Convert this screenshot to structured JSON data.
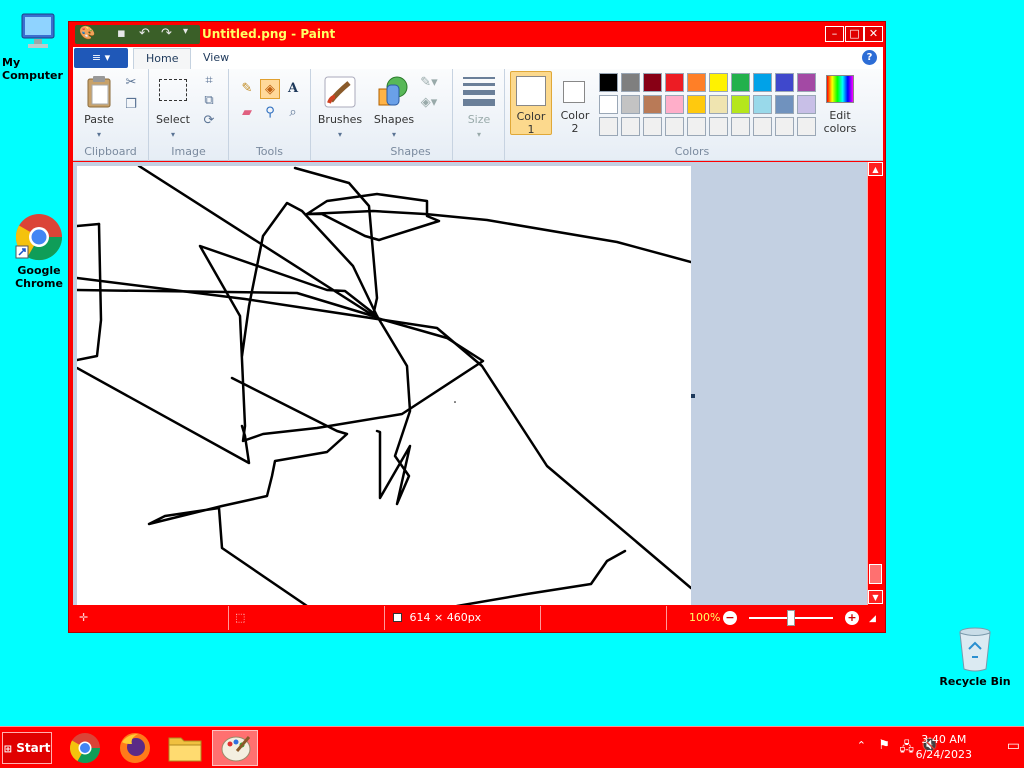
{
  "desktop": {
    "icons": [
      {
        "label": "My Computer"
      },
      {
        "label": "Google Chrome"
      },
      {
        "label": "Recycle Bin"
      }
    ]
  },
  "window": {
    "title": "Untitled.png - Paint",
    "controls": {
      "minimize": "–",
      "maximize": "□",
      "close": "✕"
    },
    "menu_button": "≡ ▾",
    "tabs": [
      {
        "label": "Home"
      },
      {
        "label": "View"
      }
    ],
    "help": "?"
  },
  "ribbon": {
    "clipboard": {
      "group": "Clipboard",
      "paste": "Paste"
    },
    "image": {
      "group": "Image",
      "select": "Select"
    },
    "tools": {
      "group": "Tools",
      "text_glyph": "A"
    },
    "brushes": {
      "label": "Brushes"
    },
    "shapes": {
      "group": "Shapes",
      "label": "Shapes"
    },
    "size": {
      "label": "Size"
    },
    "colors": {
      "group": "Colors",
      "color1": "Color\n1",
      "color1_line1": "Color",
      "color1_line2": "1",
      "color2_line1": "Color",
      "color2_line2": "2",
      "edit_line1": "Edit",
      "edit_line2": "colors",
      "color1_value": "#ffffff",
      "color2_value": "#ffffff",
      "palette_row1": [
        "#000000",
        "#7f7f7f",
        "#880015",
        "#ed1c24",
        "#ff7f27",
        "#fff200",
        "#22b14c",
        "#00a2e8",
        "#3f48cc",
        "#a349a4"
      ],
      "palette_row2": [
        "#ffffff",
        "#c3c3c3",
        "#b97a57",
        "#ffaec9",
        "#ffc90e",
        "#efe4b0",
        "#b5e61d",
        "#99d9ea",
        "#7092be",
        "#c8bfe7"
      ],
      "palette_row3": [
        "#f0f0f0",
        "#f0f0f0",
        "#f0f0f0",
        "#f0f0f0",
        "#f0f0f0",
        "#f0f0f0",
        "#f0f0f0",
        "#f0f0f0",
        "#f0f0f0",
        "#f0f0f0"
      ]
    }
  },
  "status": {
    "dimensions": "614 × 460px",
    "zoom": "100%",
    "zoom_out": "−",
    "zoom_in": "+"
  },
  "taskbar": {
    "start": "Start",
    "time": "3:40 AM",
    "date": "6/24/2023"
  }
}
